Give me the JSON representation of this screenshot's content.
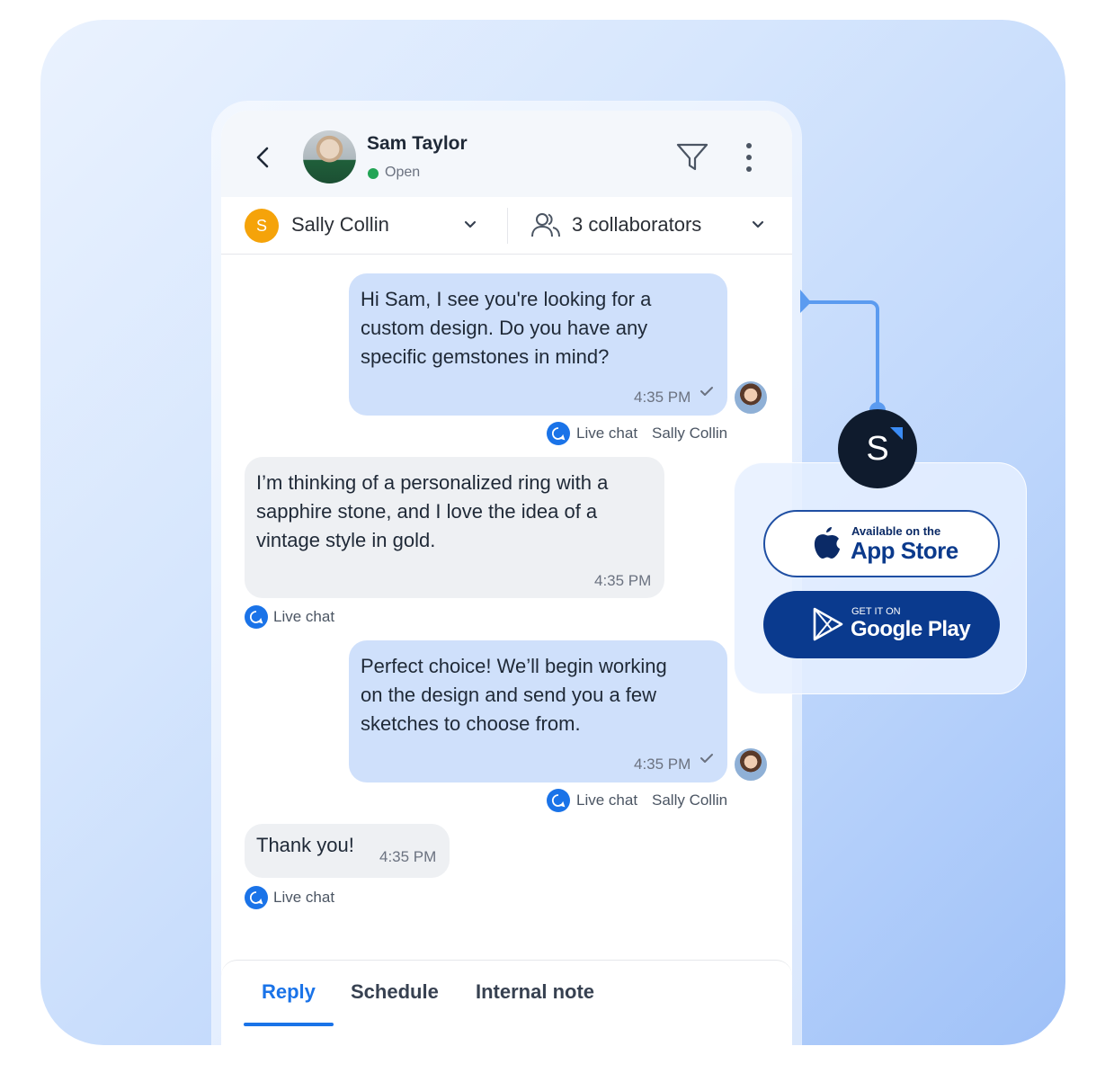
{
  "contact": {
    "name": "Sam Taylor",
    "status": "Open"
  },
  "assignment": {
    "agent_initial": "S",
    "agent_name": "Sally Collin",
    "collaborators": "3 collaborators"
  },
  "messages": [
    {
      "direction": "out",
      "text": "Hi Sam, I see you're looking for a\ncustom design. Do you have any\nspecific gemstones in mind?",
      "time": "4:35 PM",
      "channel": "Live chat",
      "agent": "Sally Collin"
    },
    {
      "direction": "in",
      "text": "I’m thinking of a personalized ring with a\nsapphire stone, and I love the idea of a\nvintage style in gold.",
      "time": "4:35 PM",
      "channel": "Live chat"
    },
    {
      "direction": "out",
      "text": "Perfect choice! We’ll begin working\non the design and send you a few\nsketches to choose from.",
      "time": "4:35 PM",
      "channel": "Live chat",
      "agent": "Sally Collin"
    },
    {
      "direction": "in",
      "text": "Thank you!",
      "time": "4:35 PM",
      "channel": "Live chat"
    }
  ],
  "tabs": [
    {
      "label": "Reply",
      "active": true
    },
    {
      "label": "Schedule",
      "active": false
    },
    {
      "label": "Internal note",
      "active": false
    }
  ],
  "brand": {
    "letter": "S"
  },
  "stores": {
    "appstore_small": "Available on the",
    "appstore_big": "App Store",
    "gplay_small": "GET IT ON",
    "gplay_big": "Google Play"
  },
  "colors": {
    "accent": "#1a73e8",
    "outgoing_bubble": "#cfe0fb",
    "incoming_bubble": "#eef0f3",
    "status_open": "#22a455",
    "agent_avatar": "#f5a30a"
  }
}
